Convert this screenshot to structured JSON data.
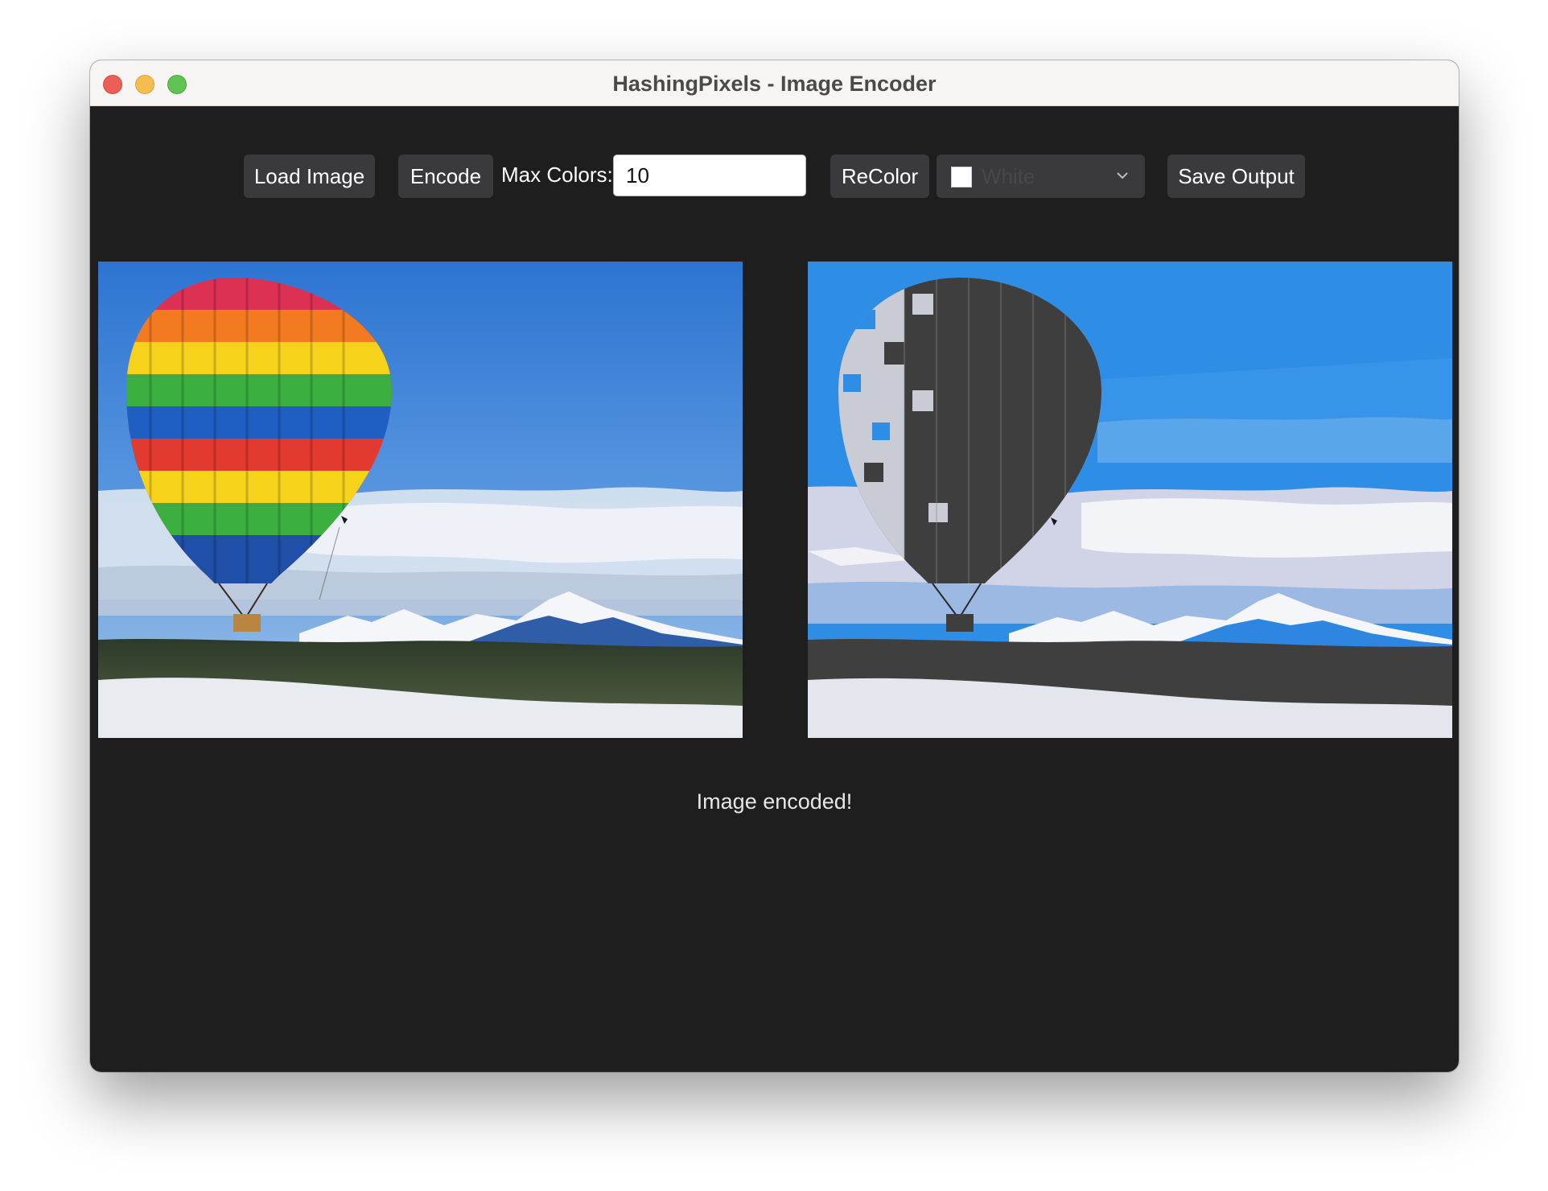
{
  "window": {
    "title": "HashingPixels - Image Encoder"
  },
  "toolbar": {
    "load_label": "Load Image",
    "encode_label": "Encode",
    "max_colors_label": "Max Colors:",
    "max_colors_value": "10",
    "recolor_label": "ReColor",
    "color_select": {
      "value": "White",
      "swatch": "#ffffff"
    },
    "save_label": "Save Output"
  },
  "status": "Image encoded!"
}
